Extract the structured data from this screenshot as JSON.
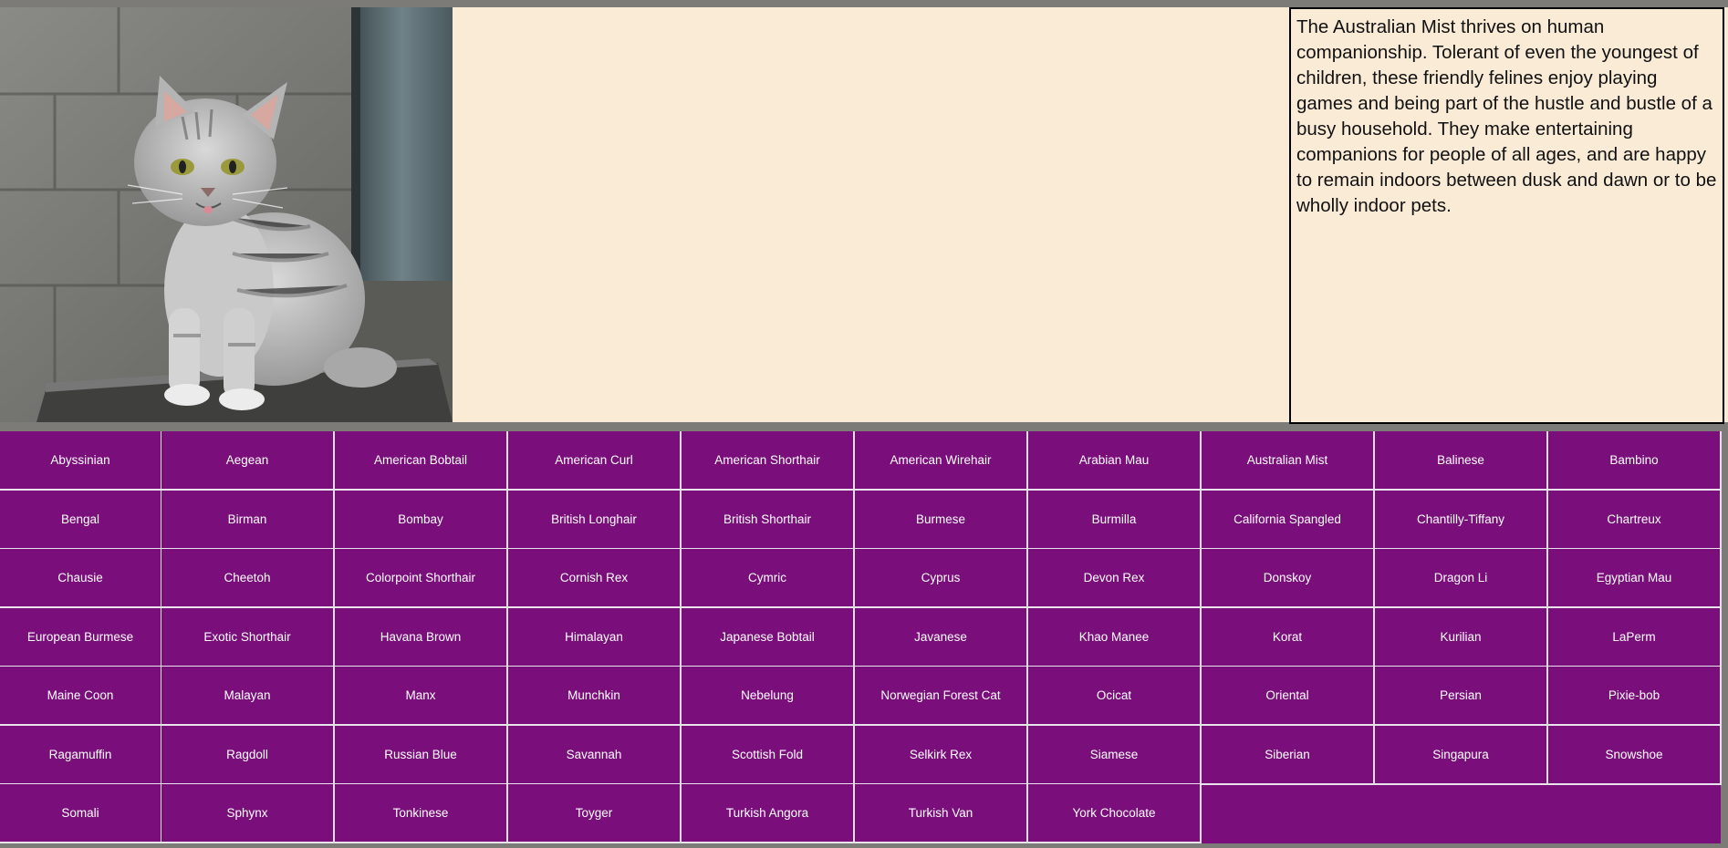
{
  "photo": {
    "subject": "grey tabby cat sitting on a ledge"
  },
  "description": "The Australian Mist thrives on human companionship. Tolerant of even the youngest of children, these friendly felines enjoy playing games and being part of the hustle and bustle of a busy household. They make entertaining companions for people of all ages, and are happy to remain indoors between dusk and dawn or to be wholly indoor pets.",
  "colors": {
    "grid": "#7a0f7c",
    "panel": "#faebd7",
    "frame": "#7d7b78"
  },
  "breeds": [
    "Abyssinian",
    "Aegean",
    "American Bobtail",
    "American Curl",
    "American Shorthair",
    "American Wirehair",
    "Arabian Mau",
    "Australian Mist",
    "Balinese",
    "Bambino",
    "Bengal",
    "Birman",
    "Bombay",
    "British Longhair",
    "British Shorthair",
    "Burmese",
    "Burmilla",
    "California Spangled",
    "Chantilly-Tiffany",
    "Chartreux",
    "Chausie",
    "Cheetoh",
    "Colorpoint Shorthair",
    "Cornish Rex",
    "Cymric",
    "Cyprus",
    "Devon Rex",
    "Donskoy",
    "Dragon Li",
    "Egyptian Mau",
    "European Burmese",
    "Exotic Shorthair",
    "Havana Brown",
    "Himalayan",
    "Japanese Bobtail",
    "Javanese",
    "Khao Manee",
    "Korat",
    "Kurilian",
    "LaPerm",
    "Maine Coon",
    "Malayan",
    "Manx",
    "Munchkin",
    "Nebelung",
    "Norwegian Forest Cat",
    "Ocicat",
    "Oriental",
    "Persian",
    "Pixie-bob",
    "Ragamuffin",
    "Ragdoll",
    "Russian Blue",
    "Savannah",
    "Scottish Fold",
    "Selkirk Rex",
    "Siamese",
    "Siberian",
    "Singapura",
    "Snowshoe",
    "Somali",
    "Sphynx",
    "Tonkinese",
    "Toyger",
    "Turkish Angora",
    "Turkish Van",
    "York Chocolate"
  ]
}
